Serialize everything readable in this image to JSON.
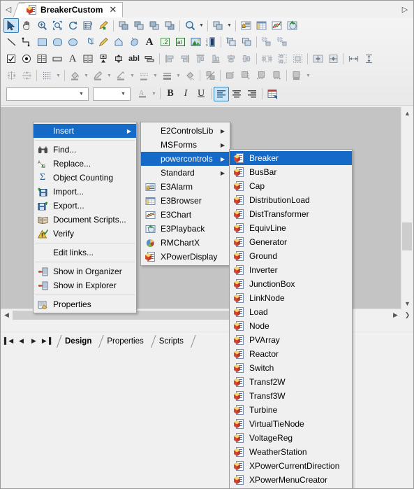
{
  "window": {
    "title": "BreakerCustom",
    "tab_close_label": "✕",
    "tab_nav_left": "◁",
    "tab_nav_right": "▷",
    "tab_icon": "document-cube-icon"
  },
  "toolbars": {
    "row1": [
      {
        "name": "select-arrow-tool",
        "label": "Select",
        "selected": true
      },
      {
        "name": "pan-hand-tool",
        "label": "Pan"
      },
      {
        "name": "zoom-tool",
        "label": "Zoom"
      },
      {
        "name": "zoom-window-tool",
        "label": "Zoom Window"
      },
      {
        "name": "rotate-tool",
        "label": "Rotate"
      },
      {
        "name": "list-edit-tool",
        "label": "List"
      },
      {
        "name": "format-painter-tool",
        "label": "Format Painter"
      },
      {
        "name": "bring-to-front-tool",
        "label": "Bring To Front"
      },
      {
        "name": "bring-forward-tool",
        "label": "Bring Forward"
      },
      {
        "name": "send-backward-tool",
        "label": "Send Backward"
      },
      {
        "name": "send-to-back-tool",
        "label": "Send To Back"
      },
      {
        "name": "zoom-level-tool",
        "label": "Zoom Level"
      },
      {
        "name": "group-tool",
        "label": "Group"
      },
      {
        "name": "alarm-tool",
        "label": "Alarm"
      },
      {
        "name": "browser-tool",
        "label": "Browser"
      },
      {
        "name": "chart-tool",
        "label": "Chart"
      },
      {
        "name": "playback-tool",
        "label": "Playback"
      }
    ],
    "row2": [
      {
        "name": "line-tool",
        "label": "Line"
      },
      {
        "name": "polyline-tool",
        "label": "Polyline"
      },
      {
        "name": "rectangle-tool",
        "label": "Rectangle"
      },
      {
        "name": "rounded-rectangle-tool",
        "label": "Rounded Rectangle"
      },
      {
        "name": "ellipse-tool",
        "label": "Ellipse"
      },
      {
        "name": "pie-tool",
        "label": "Pie"
      },
      {
        "name": "pencil-tool",
        "label": "Pencil"
      },
      {
        "name": "polygon-tool",
        "label": "Polygon"
      },
      {
        "name": "fill-shape-tool",
        "label": "Fill Shape"
      },
      {
        "name": "text-tool",
        "label": "Text"
      },
      {
        "name": "numeric-display-tool",
        "label": "Numeric Display"
      },
      {
        "name": "alpha-display-tool",
        "label": "Alpha Display"
      },
      {
        "name": "image-tool",
        "label": "Image"
      },
      {
        "name": "counter-tool",
        "label": "Counter"
      },
      {
        "name": "union-tool",
        "label": "Union"
      },
      {
        "name": "subtract-tool",
        "label": "Subtract"
      },
      {
        "name": "split-tool",
        "label": "Split"
      },
      {
        "name": "detach-tool",
        "label": "Detach"
      }
    ],
    "row3": [
      {
        "name": "checkbox-control-tool",
        "label": "CheckBox"
      },
      {
        "name": "radio-button-control-tool",
        "label": "OptionButton"
      },
      {
        "name": "listbox-control-tool",
        "label": "ListBox"
      },
      {
        "name": "commandbutton-control-tool",
        "label": "CommandButton"
      },
      {
        "name": "label-control-tool",
        "label": "Label"
      },
      {
        "name": "combobox-control-tool",
        "label": "ComboBox"
      },
      {
        "name": "spinbutton-control-tool",
        "label": "SpinButton"
      },
      {
        "name": "scrollbar-control-tool",
        "label": "ScrollBar"
      },
      {
        "name": "textbox-control-tool",
        "label": "TextBox"
      },
      {
        "name": "toggle-control-tool",
        "label": "ToggleButton"
      },
      {
        "name": "align-left-tool",
        "label": "Align Left"
      },
      {
        "name": "align-right-tool",
        "label": "Align Right"
      },
      {
        "name": "align-top-tool",
        "label": "Align Top"
      },
      {
        "name": "align-bottom-tool",
        "label": "Align Bottom"
      },
      {
        "name": "align-center-vertical-tool",
        "label": "Center Vertically"
      },
      {
        "name": "align-center-horizontal-tool",
        "label": "Center Horizontally"
      },
      {
        "name": "space-across-tool",
        "label": "Space Across"
      },
      {
        "name": "space-down-tool",
        "label": "Space Down"
      },
      {
        "name": "make-same-size-tool",
        "label": "Make Same Size"
      },
      {
        "name": "same-width-tool",
        "label": "Same Width"
      },
      {
        "name": "same-height-tool",
        "label": "Same Height"
      },
      {
        "name": "center-in-form-h-tool",
        "label": "Center In Form Horizontally"
      },
      {
        "name": "center-in-form-v-tool",
        "label": "Center In Form Vertically"
      }
    ],
    "row4": [
      {
        "name": "flip-horizontal-tool",
        "label": "Flip Horizontal"
      },
      {
        "name": "flip-vertical-tool",
        "label": "Flip Vertical"
      },
      {
        "name": "grid-tool",
        "label": "Grid"
      },
      {
        "name": "fill-color-tool",
        "label": "Fill Color"
      },
      {
        "name": "background-color-tool",
        "label": "Background Color"
      },
      {
        "name": "line-color-tool",
        "label": "Line Color"
      },
      {
        "name": "line-style-tool",
        "label": "Line Style"
      },
      {
        "name": "line-weight-tool",
        "label": "Line Weight"
      },
      {
        "name": "gradient-tool",
        "label": "Gradient"
      },
      {
        "name": "transparent-tool",
        "label": "Transparent"
      },
      {
        "name": "shadow-tool",
        "label": "Shadow"
      },
      {
        "name": "shadow-offset-tool",
        "label": "Shadow Offset"
      },
      {
        "name": "left-margin-tool",
        "label": "Left Margin"
      },
      {
        "name": "right-margin-tool",
        "label": "Right Margin"
      },
      {
        "name": "style-tool",
        "label": "Style"
      }
    ],
    "font_row": {
      "font_name_value": "",
      "font_size_value": "",
      "font_color_label": "A",
      "bold_label": "B",
      "italic_label": "I",
      "underline_label": "U",
      "align_left_label": "align-left",
      "align_center_label": "align-center",
      "align_right_label": "align-right",
      "properties_label": "properties"
    }
  },
  "context_menu": {
    "items": [
      {
        "label": "Insert",
        "icon": "none",
        "submenu": true,
        "highlighted": true
      },
      {
        "separator": true
      },
      {
        "label": "Find...",
        "icon": "binoculars-icon"
      },
      {
        "label": "Replace...",
        "icon": "replace-icon"
      },
      {
        "label": "Object Counting",
        "icon": "sigma-icon"
      },
      {
        "label": "Import...",
        "icon": "import-icon"
      },
      {
        "label": "Export...",
        "icon": "export-icon"
      },
      {
        "label": "Document Scripts...",
        "icon": "book-icon"
      },
      {
        "label": "Verify",
        "icon": "warning-check-icon"
      },
      {
        "separator": true
      },
      {
        "label": "Edit links...",
        "icon": "none"
      },
      {
        "separator": true
      },
      {
        "label": "Show in Organizer",
        "icon": "organizer-icon"
      },
      {
        "label": "Show in Explorer",
        "icon": "explorer-icon"
      },
      {
        "separator": true
      },
      {
        "label": "Properties",
        "icon": "properties-icon"
      }
    ]
  },
  "insert_menu": {
    "items": [
      {
        "label": "E2ControlsLib",
        "submenu": true,
        "icon": "none"
      },
      {
        "label": "MSForms",
        "submenu": true,
        "icon": "none"
      },
      {
        "label": "powercontrols",
        "submenu": true,
        "icon": "none",
        "highlighted": true
      },
      {
        "label": "Standard",
        "submenu": true,
        "icon": "none"
      },
      {
        "label": "E3Alarm",
        "icon": "alarm-icon"
      },
      {
        "label": "E3Browser",
        "icon": "browser-icon"
      },
      {
        "label": "E3Chart",
        "icon": "chart-icon"
      },
      {
        "label": "E3Playback",
        "icon": "playback-icon"
      },
      {
        "label": "RMChartX",
        "icon": "piechart-icon"
      },
      {
        "label": "XPowerDisplay",
        "icon": "xpower-icon"
      }
    ]
  },
  "powercontrols_menu": {
    "items": [
      {
        "label": "Breaker",
        "icon": "xpower-doc-icon",
        "highlighted": true
      },
      {
        "label": "BusBar",
        "icon": "xpower-doc-icon"
      },
      {
        "label": "Cap",
        "icon": "xpower-doc-icon"
      },
      {
        "label": "DistributionLoad",
        "icon": "xpower-doc-icon"
      },
      {
        "label": "DistTransformer",
        "icon": "xpower-doc-icon"
      },
      {
        "label": "EquivLine",
        "icon": "xpower-doc-icon"
      },
      {
        "label": "Generator",
        "icon": "xpower-doc-icon"
      },
      {
        "label": "Ground",
        "icon": "xpower-doc-icon"
      },
      {
        "label": "Inverter",
        "icon": "xpower-doc-icon"
      },
      {
        "label": "JunctionBox",
        "icon": "xpower-doc-icon"
      },
      {
        "label": "LinkNode",
        "icon": "xpower-doc-icon"
      },
      {
        "label": "Load",
        "icon": "xpower-doc-icon"
      },
      {
        "label": "Node",
        "icon": "xpower-doc-icon"
      },
      {
        "label": "PVArray",
        "icon": "xpower-doc-icon"
      },
      {
        "label": "Reactor",
        "icon": "xpower-doc-icon"
      },
      {
        "label": "Switch",
        "icon": "xpower-doc-icon"
      },
      {
        "label": "Transf2W",
        "icon": "xpower-doc-icon"
      },
      {
        "label": "Transf3W",
        "icon": "xpower-doc-icon"
      },
      {
        "label": "Turbine",
        "icon": "xpower-doc-icon"
      },
      {
        "label": "VirtualTieNode",
        "icon": "xpower-doc-icon"
      },
      {
        "label": "VoltageReg",
        "icon": "xpower-doc-icon"
      },
      {
        "label": "WeatherStation",
        "icon": "xpower-doc-icon"
      },
      {
        "label": "XPowerCurrentDirection",
        "icon": "xpower-doc-icon"
      },
      {
        "label": "XPowerMenuCreator",
        "icon": "xpower-doc-icon"
      }
    ]
  },
  "bottom": {
    "nav": [
      "▌◀",
      "◀",
      "▶",
      "▶▐"
    ],
    "tabs": [
      {
        "label": "Design",
        "active": true
      },
      {
        "label": "Properties",
        "active": false
      },
      {
        "label": "Scripts",
        "active": false
      }
    ]
  },
  "scrollbars": {
    "up_arrow": "▲",
    "down_arrow": "▼",
    "left_arrow": "◀",
    "right_arrow": "▶",
    "corner_arrow": "❯"
  },
  "colors": {
    "highlight": "#1569c7",
    "selection_border": "#3c7fb1",
    "selection_fill": "#cce4f7",
    "canvas": "#c4c4c4",
    "chrome": "#f0f0f0"
  }
}
